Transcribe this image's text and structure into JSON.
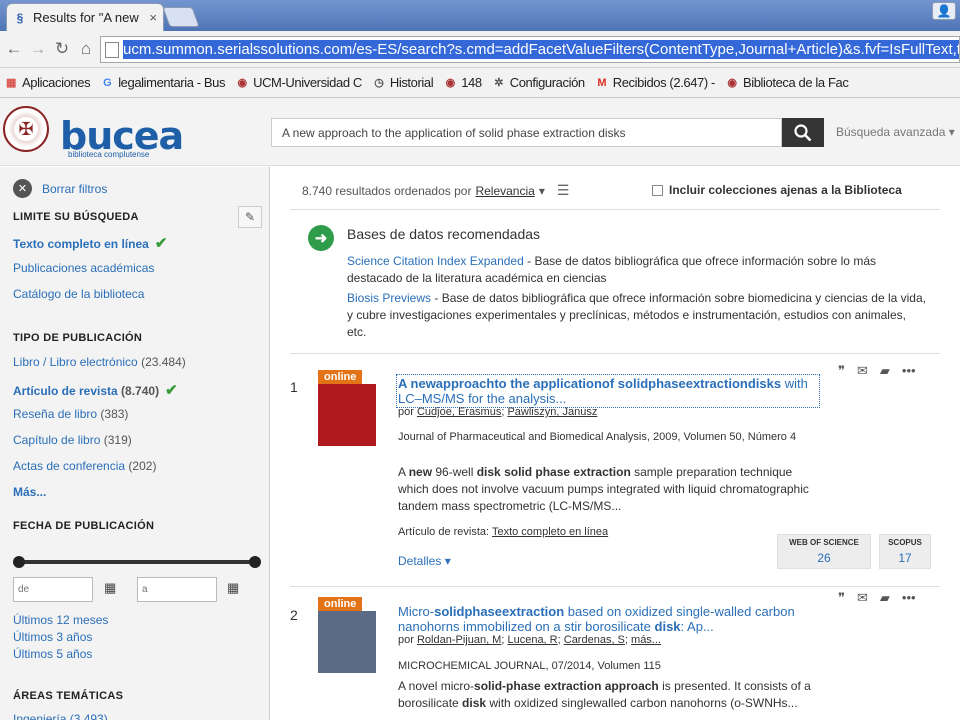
{
  "browser": {
    "tab_title": "Results for \"A new app",
    "tab_close": "×",
    "url": "ucm.summon.serialssolutions.com/es-ES/search?s.cmd=addFacetValueFilters(ContentType,Journal+Article)&s.fvf=IsFullText,true&keep_r=true&s.c",
    "bookmarks": [
      {
        "label": "Aplicaciones",
        "icon": "apps-icon",
        "glyph": "▦",
        "color": "#d9534f"
      },
      {
        "label": "legalimentaria - Bus",
        "icon": "google-icon",
        "glyph": "G",
        "color": "#4285f4"
      },
      {
        "label": "UCM-Universidad C",
        "icon": "ucm-seal-icon",
        "glyph": "◉",
        "color": "#a33"
      },
      {
        "label": "Historial",
        "icon": "history-icon",
        "glyph": "◷",
        "color": "#555"
      },
      {
        "label": "148",
        "icon": "ucm-seal-icon",
        "glyph": "◉",
        "color": "#a33"
      },
      {
        "label": "Configuración",
        "icon": "gear-icon",
        "glyph": "✲",
        "color": "#555"
      },
      {
        "label": "Recibidos (2.647) -",
        "icon": "gmail-icon",
        "glyph": "M",
        "color": "#d93025"
      },
      {
        "label": "Biblioteca de la Fac",
        "icon": "ucm-seal-icon",
        "glyph": "◉",
        "color": "#a33"
      }
    ]
  },
  "header": {
    "logo_word": "bucea",
    "logo_sub": "biblioteca complutense",
    "search_value": "A new approach to the application of solid phase extraction disks",
    "advanced": "Búsqueda avanzada ▾"
  },
  "sidebar": {
    "clear_filters": "Borrar filtros",
    "limit_heading": "LIMITE SU BÚSQUEDA",
    "limit_items": [
      {
        "label": "Texto completo en línea",
        "active": true
      },
      {
        "label": "Publicaciones académicas"
      },
      {
        "label": "Catálogo de la biblioteca"
      }
    ],
    "type_heading": "TIPO DE PUBLICACIÓN",
    "type_items": [
      {
        "label": "Libro / Libro electrónico",
        "count": "(23.484)"
      },
      {
        "label": "Artículo de revista",
        "count": "(8.740)",
        "active": true
      },
      {
        "label": "Reseña de libro",
        "count": "(383)"
      },
      {
        "label": "Capítulo de libro",
        "count": "(319)"
      },
      {
        "label": "Actas de conferencia",
        "count": "(202)"
      }
    ],
    "more": "Más...",
    "date_heading": "FECHA DE PUBLICACIÓN",
    "date_from_placeholder": "de",
    "date_to_placeholder": "a",
    "date_links": [
      "Últimos 12 meses",
      "Últimos 3 años",
      "Últimos 5 años"
    ],
    "areas_heading": "ÁREAS TEMÁTICAS",
    "areas_first": "Ingeniería (3.493)"
  },
  "main": {
    "results_count_text": "8.740 resultados ordenados por",
    "sort_label": "Relevancia",
    "include_label": "Incluir colecciones ajenas a la Biblioteca",
    "recommended": {
      "heading": "Bases de datos recomendadas",
      "db1_name": "Science Citation Index Expanded",
      "db1_desc": " - Base de datos bibliográfica que ofrece información sobre lo más destacado de la literatura académica en ciencias",
      "db2_name": "Biosis Previews",
      "db2_desc": " - Base de datos bibliográfica que ofrece información sobre biomedicina y ciencias de la vida, y cubre investigaciones experimentales y preclínicas, métodos e instrumentación, estudios con animales, etc."
    },
    "results": [
      {
        "num": "1",
        "badge": "online",
        "title_bold": "A newapproachto the applicationof solidphaseextractiondisks",
        "title_rest": " with LC–MS/MS for the analysis...",
        "by": "por",
        "authors": [
          "Cudjoe, Erasmus",
          "Pawliszyn, Janusz"
        ],
        "publication": "Journal of Pharmaceutical and Biomedical Analysis, 2009, Volumen 50, Número 4",
        "abstract_parts": [
          "A ",
          "new",
          " 96-well ",
          "disk solid phase extraction",
          " sample preparation technique which does not involve vacuum pumps integrated with liquid chromatographic tandem mass spectrometric (LC-MS/MS..."
        ],
        "type_label": "Artículo de revista:",
        "type_link": "Texto completo en línea",
        "details": "Detalles",
        "wos_label": "WEB OF SCIENCE",
        "wos_value": "26",
        "scopus_label": "SCOPUS",
        "scopus_value": "17"
      },
      {
        "num": "2",
        "badge": "online",
        "title_parts": [
          "Micro-",
          "solidphaseextraction",
          " based on oxidized single-walled carbon nanohorns immobilized on a stir borosilicate ",
          "disk",
          ": Ap..."
        ],
        "by": "por",
        "authors": [
          "Roldan-Pijuan, M",
          "Lucena, R",
          "Cardenas, S",
          "más..."
        ],
        "publication": "MICROCHEMICAL JOURNAL, 07/2014, Volumen 115",
        "abstract_parts": [
          "A novel micro-",
          "solid-phase extraction approach",
          " is presented. It consists of a borosilicate ",
          "disk",
          " with oxidized singlewalled carbon nanohorns (o-SWNHs..."
        ]
      }
    ]
  },
  "colors": {
    "link": "#2a6fb8",
    "badge": "#e27317",
    "check": "#3a9d3a",
    "recommend": "#2e9c4a"
  }
}
